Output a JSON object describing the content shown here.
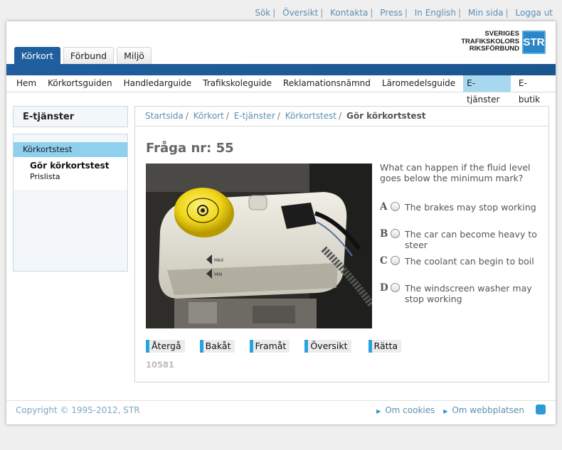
{
  "toplinks": [
    "Sök",
    "Översikt",
    "Kontakta",
    "Press",
    "In English",
    "Min sida",
    "Logga ut"
  ],
  "logo": {
    "line1": "SVERIGES",
    "line2": "TRAFIKSKOLORS",
    "line3": "RIKSFÖRBUND",
    "badge": "STR"
  },
  "tabs": [
    "Körkort",
    "Förbund",
    "Miljö"
  ],
  "nav": [
    "Hem",
    "Körkortsguiden",
    "Handledarguide",
    "Trafikskoleguide",
    "Reklamationsnämnd",
    "Läromedelsguide",
    "E-tjänster",
    "E-butik"
  ],
  "sidebar": {
    "title": "E-tjänster",
    "selected": "Körkortstest",
    "sub1": "Gör körkortstest",
    "sub2": "Prislista"
  },
  "breadcrumb": [
    "Startsida",
    "Körkort",
    "E-tjänster",
    "Körkortstest"
  ],
  "breadcrumb_current": "Gör körkortstest",
  "question": {
    "title": "Fråga nr: 55",
    "text": "What can happen if the fluid level goes below the minimum mark?",
    "answers": [
      {
        "letter": "A",
        "text": "The brakes may stop working"
      },
      {
        "letter": "B",
        "text": "The car can become heavy to steer"
      },
      {
        "letter": "C",
        "text": "The coolant can begin to boil"
      },
      {
        "letter": "D",
        "text": "The windscreen washer may stop working"
      }
    ],
    "image_labels": {
      "max": "MAX",
      "min": "MIN"
    }
  },
  "buttons": [
    "Återgå",
    "Bakåt",
    "Framåt",
    "Översikt",
    "Rätta"
  ],
  "question_id": "10581",
  "footer": {
    "copyright": "Copyright © 1995-2012, STR",
    "links": [
      "Om cookies",
      "Om webbplatsen"
    ]
  },
  "colors": {
    "brand_blue": "#1f5f9e",
    "accent_cyan": "#2aa2e2",
    "nav_active": "#a8d8f0"
  }
}
